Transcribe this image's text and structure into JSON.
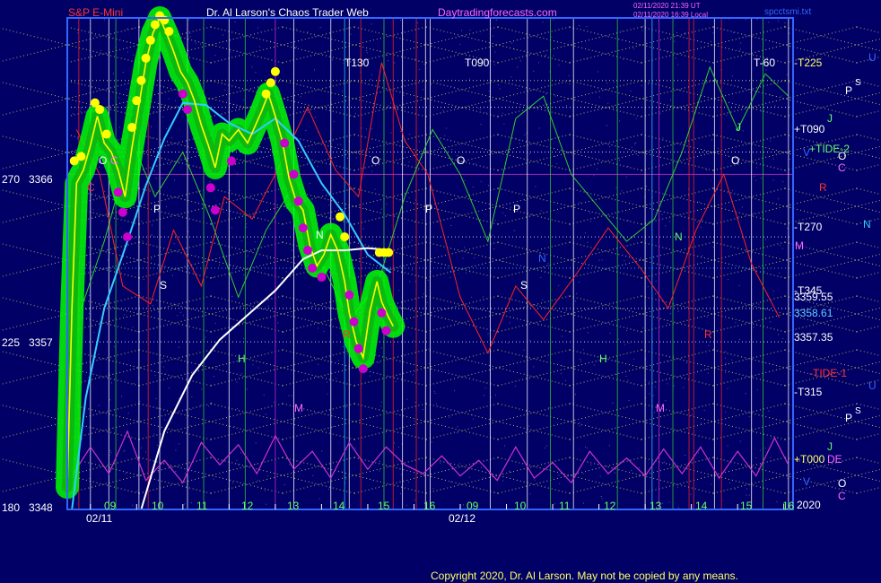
{
  "header": {
    "instrument": "S&P E-Mini",
    "title": "Dr. Al Larson's Chaos Trader Web",
    "site": "Daytradingforecasts.com",
    "stamp_1": "02/11/2020 21:39 UT",
    "stamp_2": "02/11/2020 16:39 Local",
    "file": "spcctsmi.txt"
  },
  "left_axis": [
    {
      "angle": "270",
      "price": "3366"
    },
    {
      "angle": "225",
      "price": "3357"
    },
    {
      "angle": "180",
      "price": "3348"
    }
  ],
  "right_labels": [
    {
      "text": "-T225",
      "color": "#ffff66"
    },
    {
      "text": "+T090",
      "color": "#ffffff"
    },
    {
      "text": "+TIDE-2",
      "color": "#66ff66"
    },
    {
      "text": "-T270",
      "color": "#ffffff"
    },
    {
      "text": "-T345",
      "color": "#ffffff"
    },
    {
      "text": "3359.55",
      "color": "#ffffff"
    },
    {
      "text": "3358.61",
      "color": "#66ccff"
    },
    {
      "text": "3357.35",
      "color": "#ffffff"
    },
    {
      "text": "-TIDE-1",
      "color": "#ff3333"
    },
    {
      "text": "-T315",
      "color": "#ffffff"
    },
    {
      "text": "+T000",
      "color": "#ffff66"
    },
    {
      "text": "DE",
      "color": "#ff66ff"
    },
    {
      "text": "2020",
      "color": "#ffffff"
    }
  ],
  "planet_glyphs": [
    {
      "text": "U",
      "color": "#3366ff"
    },
    {
      "text": "P",
      "color": "#ffffff"
    },
    {
      "text": "S",
      "color": "#ffffff"
    },
    {
      "text": "J",
      "color": "#66ff66"
    },
    {
      "text": "V",
      "color": "#3366ff"
    },
    {
      "text": "O",
      "color": "#ffffff"
    },
    {
      "text": "C",
      "color": "#ff66ff"
    },
    {
      "text": "R",
      "color": "#ff3333"
    },
    {
      "text": "N",
      "color": "#33ccff"
    },
    {
      "text": "M",
      "color": "#ff66ff"
    },
    {
      "text": "U",
      "color": "#3366ff"
    },
    {
      "text": "P",
      "color": "#ffffff"
    },
    {
      "text": "S",
      "color": "#ffffff"
    },
    {
      "text": "J",
      "color": "#66ff66"
    },
    {
      "text": "V",
      "color": "#3366ff"
    },
    {
      "text": "O",
      "color": "#ffffff"
    },
    {
      "text": "C",
      "color": "#ff66ff"
    }
  ],
  "time_markers": [
    {
      "text": "T130",
      "color": "#ffffff"
    },
    {
      "text": "T090",
      "color": "#ffffff"
    },
    {
      "text": "T-60",
      "color": "#ffffff"
    }
  ],
  "chart_letters": [
    {
      "text": "O",
      "color": "#ffffff"
    },
    {
      "text": "O",
      "color": "#ffffff"
    },
    {
      "text": "O",
      "color": "#ffffff"
    },
    {
      "text": "O",
      "color": "#ffffff"
    },
    {
      "text": "C",
      "color": "#ff66ff"
    },
    {
      "text": "C",
      "color": "#ff3333"
    },
    {
      "text": "P",
      "color": "#ffffff"
    },
    {
      "text": "P",
      "color": "#ffffff"
    },
    {
      "text": "P",
      "color": "#ffffff"
    },
    {
      "text": "S",
      "color": "#ffffff"
    },
    {
      "text": "S",
      "color": "#ffffff"
    },
    {
      "text": "N",
      "color": "#ffffff"
    },
    {
      "text": "N",
      "color": "#3366ff"
    },
    {
      "text": "N",
      "color": "#66ff66"
    },
    {
      "text": "H",
      "color": "#66ff66"
    },
    {
      "text": "H",
      "color": "#66ff66"
    },
    {
      "text": "M",
      "color": "#ff66ff"
    },
    {
      "text": "M",
      "color": "#ff66ff"
    },
    {
      "text": "R",
      "color": "#ff3333"
    },
    {
      "text": "R",
      "color": "#ff3333"
    },
    {
      "text": "J",
      "color": "#66ff66"
    }
  ],
  "x_axis": {
    "hours": [
      "09",
      "10",
      "11",
      "12",
      "13",
      "14",
      "15",
      "16",
      "09",
      "10",
      "11",
      "12",
      "13",
      "14",
      "15",
      "16"
    ],
    "dates": [
      "02/11",
      "02/12"
    ]
  },
  "footer": {
    "copyright": "Copyright 2020, Dr. Al Larson. May not be copied by any means."
  },
  "chart_data": {
    "type": "line",
    "ylim": [
      3348,
      3370
    ],
    "x_range_hours": [
      8.5,
      24.2
    ],
    "y_tick_prices": [
      3366,
      3357,
      3348
    ],
    "colors": {
      "background": "#000066",
      "plot_bg": "#000066",
      "frame": "#3366ff",
      "price": "#ffff00",
      "envelope": "#00ff00",
      "highs": "#ffff00",
      "lows": "#cc00cc",
      "ma_cyan": "#33ccff",
      "ma_white": "#ffffff",
      "tide_red": "#ff2222",
      "tide_green": "#33cc33",
      "osc_magenta": "#cc33cc",
      "grid_yellow": "#ffff66"
    },
    "vertical_lines": {
      "white": [
        9.0,
        9.4,
        10.05,
        10.5,
        11.1,
        12.0,
        13.4,
        14.2,
        14.6,
        15.75,
        16.25,
        16.35,
        17.65,
        18.45,
        19.45,
        21.0,
        22.5,
        23.3,
        24.1
      ],
      "green": [
        9.55,
        11.45,
        12.35,
        15.35,
        18.95,
        20.4,
        21.6,
        23.55
      ],
      "red": [
        8.75,
        10.25,
        14.85,
        15.55,
        16.05,
        21.95,
        22.05,
        22.65
      ],
      "magenta": [
        13.0,
        21.3
      ],
      "cyan": [
        14.5,
        21.15
      ]
    },
    "price": [
      {
        "x": 8.5,
        "y": 3349.0
      },
      {
        "x": 8.6,
        "y": 3357.0
      },
      {
        "x": 8.7,
        "y": 3362.6
      },
      {
        "x": 8.85,
        "y": 3363.2
      },
      {
        "x": 9.0,
        "y": 3364.3
      },
      {
        "x": 9.15,
        "y": 3365.6
      },
      {
        "x": 9.3,
        "y": 3364.4
      },
      {
        "x": 9.45,
        "y": 3364.0
      },
      {
        "x": 9.6,
        "y": 3363.2
      },
      {
        "x": 9.75,
        "y": 3362.0
      },
      {
        "x": 9.9,
        "y": 3364.2
      },
      {
        "x": 10.05,
        "y": 3366.1
      },
      {
        "x": 10.2,
        "y": 3368.0
      },
      {
        "x": 10.35,
        "y": 3369.3
      },
      {
        "x": 10.5,
        "y": 3370.0
      },
      {
        "x": 10.65,
        "y": 3369.3
      },
      {
        "x": 10.8,
        "y": 3368.5
      },
      {
        "x": 10.95,
        "y": 3367.6
      },
      {
        "x": 11.1,
        "y": 3367.1
      },
      {
        "x": 11.25,
        "y": 3366.3
      },
      {
        "x": 11.4,
        "y": 3365.2
      },
      {
        "x": 11.55,
        "y": 3364.3
      },
      {
        "x": 11.7,
        "y": 3363.3
      },
      {
        "x": 11.85,
        "y": 3364.8
      },
      {
        "x": 12.0,
        "y": 3364.5
      },
      {
        "x": 12.2,
        "y": 3365.0
      },
      {
        "x": 12.4,
        "y": 3364.4
      },
      {
        "x": 12.55,
        "y": 3365.1
      },
      {
        "x": 12.7,
        "y": 3365.8
      },
      {
        "x": 12.85,
        "y": 3366.6
      },
      {
        "x": 13.0,
        "y": 3365.6
      },
      {
        "x": 13.15,
        "y": 3364.5
      },
      {
        "x": 13.3,
        "y": 3362.8
      },
      {
        "x": 13.45,
        "y": 3361.8
      },
      {
        "x": 13.6,
        "y": 3361.4
      },
      {
        "x": 13.75,
        "y": 3359.8
      },
      {
        "x": 13.9,
        "y": 3358.9
      },
      {
        "x": 14.05,
        "y": 3359.4
      },
      {
        "x": 14.2,
        "y": 3360.3
      },
      {
        "x": 14.35,
        "y": 3359.6
      },
      {
        "x": 14.5,
        "y": 3358.2
      },
      {
        "x": 14.6,
        "y": 3356.8
      },
      {
        "x": 14.75,
        "y": 3355.5
      },
      {
        "x": 14.9,
        "y": 3354.8
      },
      {
        "x": 15.05,
        "y": 3356.9
      },
      {
        "x": 15.2,
        "y": 3358.2
      },
      {
        "x": 15.3,
        "y": 3357.3
      },
      {
        "x": 15.45,
        "y": 3356.6
      },
      {
        "x": 15.55,
        "y": 3356.2
      }
    ],
    "swing_highs": [
      {
        "x": 8.65,
        "y": 3363.6
      },
      {
        "x": 8.8,
        "y": 3363.8
      },
      {
        "x": 9.1,
        "y": 3366.2
      },
      {
        "x": 9.2,
        "y": 3365.9
      },
      {
        "x": 9.35,
        "y": 3364.8
      },
      {
        "x": 9.9,
        "y": 3365.1
      },
      {
        "x": 10.0,
        "y": 3366.3
      },
      {
        "x": 10.1,
        "y": 3367.2
      },
      {
        "x": 10.2,
        "y": 3368.2
      },
      {
        "x": 10.3,
        "y": 3369.0
      },
      {
        "x": 10.4,
        "y": 3369.7
      },
      {
        "x": 10.5,
        "y": 3370.1
      },
      {
        "x": 10.6,
        "y": 3369.9
      },
      {
        "x": 10.7,
        "y": 3369.4
      },
      {
        "x": 12.8,
        "y": 3366.6
      },
      {
        "x": 12.9,
        "y": 3367.1
      },
      {
        "x": 13.0,
        "y": 3367.6
      },
      {
        "x": 14.4,
        "y": 3361.1
      },
      {
        "x": 14.5,
        "y": 3360.2
      },
      {
        "x": 15.25,
        "y": 3359.5
      },
      {
        "x": 15.35,
        "y": 3359.5
      },
      {
        "x": 15.45,
        "y": 3359.5
      }
    ],
    "swing_lows": [
      {
        "x": 9.6,
        "y": 3362.2
      },
      {
        "x": 9.7,
        "y": 3361.3
      },
      {
        "x": 9.8,
        "y": 3360.2
      },
      {
        "x": 11.0,
        "y": 3366.6
      },
      {
        "x": 11.1,
        "y": 3365.9
      },
      {
        "x": 11.6,
        "y": 3362.4
      },
      {
        "x": 11.7,
        "y": 3361.4
      },
      {
        "x": 12.05,
        "y": 3363.6
      },
      {
        "x": 13.2,
        "y": 3364.4
      },
      {
        "x": 13.4,
        "y": 3363.0
      },
      {
        "x": 13.5,
        "y": 3361.8
      },
      {
        "x": 13.6,
        "y": 3360.6
      },
      {
        "x": 13.7,
        "y": 3359.6
      },
      {
        "x": 13.8,
        "y": 3358.8
      },
      {
        "x": 14.0,
        "y": 3358.4
      },
      {
        "x": 14.6,
        "y": 3357.6
      },
      {
        "x": 14.7,
        "y": 3356.4
      },
      {
        "x": 14.8,
        "y": 3355.2
      },
      {
        "x": 14.9,
        "y": 3354.3
      },
      {
        "x": 15.3,
        "y": 3356.8
      },
      {
        "x": 15.4,
        "y": 3356.0
      }
    ],
    "ma_cyan": [
      {
        "x": 8.6,
        "y": 3348.0
      },
      {
        "x": 8.9,
        "y": 3353.0
      },
      {
        "x": 9.3,
        "y": 3357.0
      },
      {
        "x": 9.8,
        "y": 3360.0
      },
      {
        "x": 10.2,
        "y": 3362.5
      },
      {
        "x": 10.6,
        "y": 3364.6
      },
      {
        "x": 11.0,
        "y": 3366.2
      },
      {
        "x": 11.5,
        "y": 3366.1
      },
      {
        "x": 12.0,
        "y": 3365.3
      },
      {
        "x": 12.5,
        "y": 3364.8
      },
      {
        "x": 13.0,
        "y": 3365.5
      },
      {
        "x": 13.5,
        "y": 3364.5
      },
      {
        "x": 14.0,
        "y": 3362.6
      },
      {
        "x": 14.5,
        "y": 3361.2
      },
      {
        "x": 15.0,
        "y": 3359.4
      },
      {
        "x": 15.5,
        "y": 3358.6
      }
    ],
    "ma_white": [
      {
        "x": 10.1,
        "y": 3348.0
      },
      {
        "x": 10.6,
        "y": 3351.5
      },
      {
        "x": 11.2,
        "y": 3354.0
      },
      {
        "x": 11.8,
        "y": 3355.6
      },
      {
        "x": 12.4,
        "y": 3356.7
      },
      {
        "x": 13.0,
        "y": 3357.8
      },
      {
        "x": 13.6,
        "y": 3359.2
      },
      {
        "x": 14.0,
        "y": 3359.6
      },
      {
        "x": 14.5,
        "y": 3359.6
      },
      {
        "x": 15.0,
        "y": 3359.7
      },
      {
        "x": 15.5,
        "y": 3359.6
      }
    ],
    "tide_red": [
      {
        "x": 8.7,
        "y": 3365.0
      },
      {
        "x": 9.2,
        "y": 3363.0
      },
      {
        "x": 9.7,
        "y": 3358.0
      },
      {
        "x": 10.3,
        "y": 3357.2
      },
      {
        "x": 10.8,
        "y": 3360.5
      },
      {
        "x": 11.4,
        "y": 3358.0
      },
      {
        "x": 11.9,
        "y": 3362.0
      },
      {
        "x": 12.5,
        "y": 3361.0
      },
      {
        "x": 13.0,
        "y": 3363.0
      },
      {
        "x": 13.7,
        "y": 3366.0
      },
      {
        "x": 14.3,
        "y": 3363.2
      },
      {
        "x": 14.8,
        "y": 3362.0
      },
      {
        "x": 15.3,
        "y": 3368.0
      },
      {
        "x": 15.8,
        "y": 3364.5
      },
      {
        "x": 16.3,
        "y": 3363.0
      },
      {
        "x": 17.0,
        "y": 3357.5
      },
      {
        "x": 17.6,
        "y": 3355.0
      },
      {
        "x": 18.2,
        "y": 3358.0
      },
      {
        "x": 18.8,
        "y": 3356.5
      },
      {
        "x": 19.5,
        "y": 3358.5
      },
      {
        "x": 20.2,
        "y": 3360.6
      },
      {
        "x": 20.9,
        "y": 3358.8
      },
      {
        "x": 21.5,
        "y": 3357.0
      },
      {
        "x": 22.1,
        "y": 3360.5
      },
      {
        "x": 22.7,
        "y": 3363.0
      },
      {
        "x": 23.3,
        "y": 3359.0
      },
      {
        "x": 23.9,
        "y": 3356.6
      }
    ],
    "tide_green": [
      {
        "x": 8.8,
        "y": 3357.0
      },
      {
        "x": 9.3,
        "y": 3360.0
      },
      {
        "x": 9.9,
        "y": 3364.5
      },
      {
        "x": 10.4,
        "y": 3362.0
      },
      {
        "x": 11.0,
        "y": 3364.0
      },
      {
        "x": 11.6,
        "y": 3361.0
      },
      {
        "x": 12.2,
        "y": 3357.5
      },
      {
        "x": 12.8,
        "y": 3360.5
      },
      {
        "x": 13.4,
        "y": 3362.5
      },
      {
        "x": 14.0,
        "y": 3359.0
      },
      {
        "x": 14.6,
        "y": 3356.5
      },
      {
        "x": 15.2,
        "y": 3358.0
      },
      {
        "x": 15.8,
        "y": 3362.0
      },
      {
        "x": 16.4,
        "y": 3365.0
      },
      {
        "x": 17.0,
        "y": 3363.0
      },
      {
        "x": 17.6,
        "y": 3360.0
      },
      {
        "x": 18.2,
        "y": 3365.5
      },
      {
        "x": 18.8,
        "y": 3366.5
      },
      {
        "x": 19.4,
        "y": 3363.0
      },
      {
        "x": 20.0,
        "y": 3361.5
      },
      {
        "x": 20.6,
        "y": 3360.0
      },
      {
        "x": 21.2,
        "y": 3361.0
      },
      {
        "x": 21.8,
        "y": 3364.0
      },
      {
        "x": 22.4,
        "y": 3367.8
      },
      {
        "x": 23.0,
        "y": 3365.0
      },
      {
        "x": 23.6,
        "y": 3367.5
      },
      {
        "x": 24.1,
        "y": 3366.5
      }
    ],
    "osc_magenta": [
      {
        "x": 8.6,
        "y": 3349.5
      },
      {
        "x": 9.0,
        "y": 3350.8
      },
      {
        "x": 9.4,
        "y": 3349.6
      },
      {
        "x": 9.8,
        "y": 3351.5
      },
      {
        "x": 10.2,
        "y": 3349.3
      },
      {
        "x": 10.6,
        "y": 3350.2
      },
      {
        "x": 11.0,
        "y": 3349.2
      },
      {
        "x": 11.4,
        "y": 3351.0
      },
      {
        "x": 11.8,
        "y": 3350.0
      },
      {
        "x": 12.2,
        "y": 3350.9
      },
      {
        "x": 12.6,
        "y": 3349.6
      },
      {
        "x": 13.0,
        "y": 3351.3
      },
      {
        "x": 13.4,
        "y": 3349.8
      },
      {
        "x": 13.8,
        "y": 3350.6
      },
      {
        "x": 14.2,
        "y": 3349.4
      },
      {
        "x": 14.6,
        "y": 3351.0
      },
      {
        "x": 15.0,
        "y": 3349.8
      },
      {
        "x": 15.4,
        "y": 3350.8
      },
      {
        "x": 15.8,
        "y": 3350.0
      },
      {
        "x": 16.2,
        "y": 3349.6
      },
      {
        "x": 16.6,
        "y": 3350.4
      },
      {
        "x": 17.0,
        "y": 3349.5
      },
      {
        "x": 17.4,
        "y": 3350.2
      },
      {
        "x": 17.8,
        "y": 3349.3
      },
      {
        "x": 18.2,
        "y": 3350.8
      },
      {
        "x": 18.6,
        "y": 3349.4
      },
      {
        "x": 19.0,
        "y": 3350.1
      },
      {
        "x": 19.4,
        "y": 3349.2
      },
      {
        "x": 19.8,
        "y": 3350.6
      },
      {
        "x": 20.2,
        "y": 3349.6
      },
      {
        "x": 20.6,
        "y": 3350.3
      },
      {
        "x": 21.0,
        "y": 3349.5
      },
      {
        "x": 21.4,
        "y": 3350.7
      },
      {
        "x": 21.8,
        "y": 3349.6
      },
      {
        "x": 22.2,
        "y": 3350.8
      },
      {
        "x": 22.6,
        "y": 3349.4
      },
      {
        "x": 23.0,
        "y": 3350.6
      },
      {
        "x": 23.4,
        "y": 3349.5
      },
      {
        "x": 23.8,
        "y": 3351.2
      },
      {
        "x": 24.1,
        "y": 3350.0
      }
    ],
    "horizontal_levels": [
      {
        "price": 3366.0,
        "color": "#ffffff",
        "style": "dotted"
      },
      {
        "price": 3357.0,
        "color": "#ffffff",
        "style": "dotted"
      },
      {
        "price": 3367.2,
        "color": "#ffff66",
        "style": "dotted"
      },
      {
        "price": 3364.0,
        "color": "#ffffff",
        "style": "dotted"
      },
      {
        "price": 3363.0,
        "color": "#cc33cc",
        "style": "solid"
      },
      {
        "price": 3360.2,
        "color": "#ffffff",
        "style": "dotted"
      },
      {
        "price": 3358.8,
        "color": "#33ccff",
        "style": "dotted"
      },
      {
        "price": 3355.5,
        "color": "#ffffff",
        "style": "dotted"
      }
    ]
  }
}
